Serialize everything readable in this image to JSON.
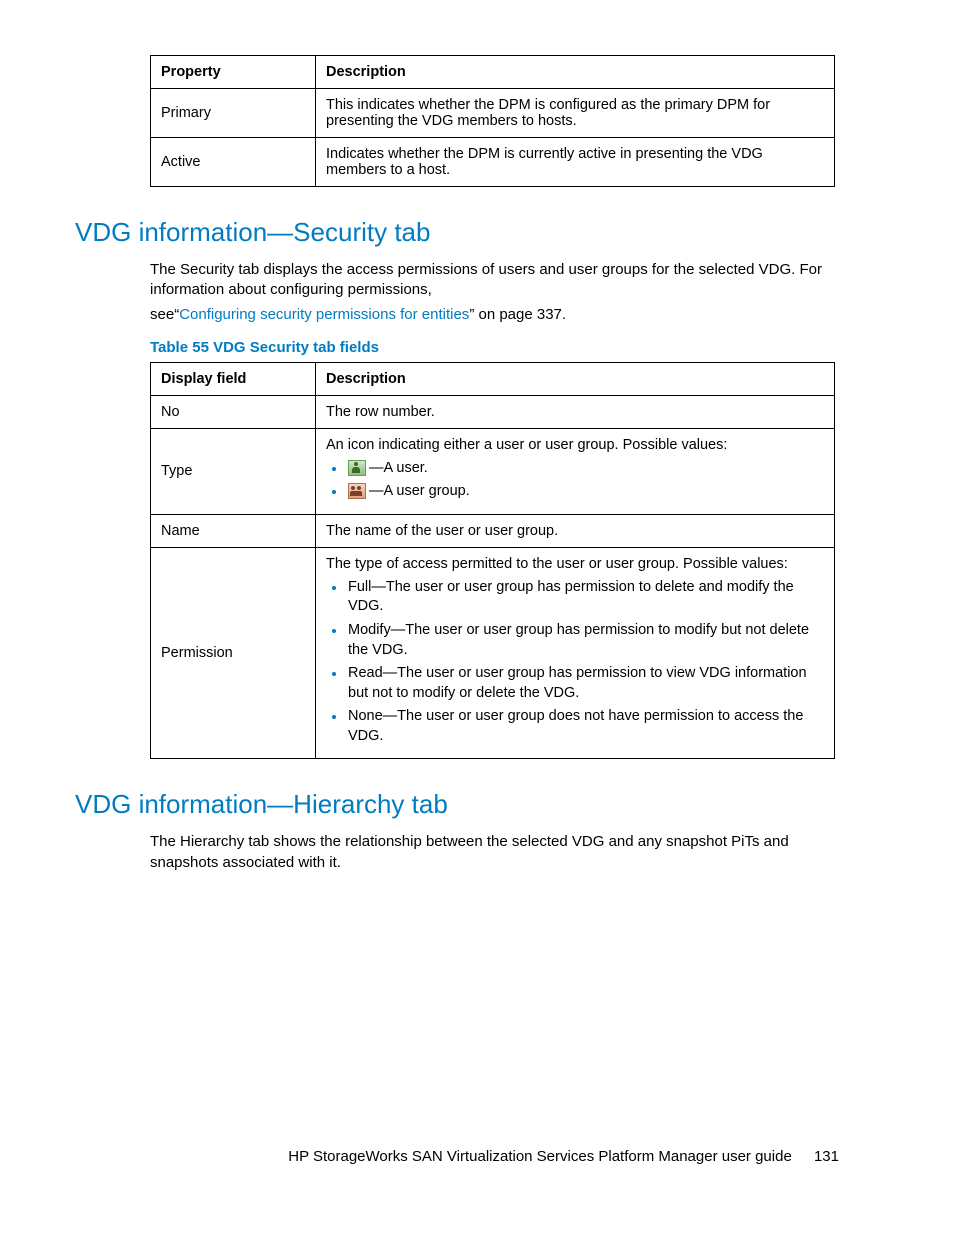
{
  "table1": {
    "headers": [
      "Property",
      "Description"
    ],
    "rows": [
      {
        "property": "Primary",
        "description": "This indicates whether the DPM is configured as the primary DPM for presenting the VDG members to hosts."
      },
      {
        "property": "Active",
        "description": "Indicates whether the DPM is currently active in presenting the VDG members to a host."
      }
    ]
  },
  "security": {
    "heading": "VDG information—Security tab",
    "intro_a": "The Security tab displays the access permissions of users and user groups for the selected VDG. For information about configuring permissions,",
    "intro_see": "see",
    "link_text": "Configuring security permissions for entities",
    "intro_tail": " on page 337.",
    "table_caption": "Table 55 VDG Security tab fields",
    "headers": [
      "Display field",
      "Description"
    ],
    "row_no": {
      "field": "No",
      "desc": "The row number."
    },
    "row_type": {
      "field": "Type",
      "intro": "An icon indicating either a user or user group. Possible values:",
      "user_label": "—A user.",
      "group_label": "—A user group."
    },
    "row_name": {
      "field": "Name",
      "desc": "The name of the user or user group."
    },
    "row_perm": {
      "field": "Permission",
      "intro": "The type of access permitted to the user or user group. Possible values:",
      "items": [
        "Full—The user or user group has permission to delete and modify the VDG.",
        "Modify—The user or user group has permission to modify but not delete the VDG.",
        "Read—The user or user group has permission to view VDG information but not to modify or delete the VDG.",
        "None—The user or user group does not have permission to access the VDG."
      ]
    }
  },
  "hierarchy": {
    "heading": "VDG information—Hierarchy tab",
    "text": "The Hierarchy tab shows the relationship between the selected VDG and any snapshot PiTs and snapshots associated with it."
  },
  "footer": {
    "title": "HP StorageWorks SAN Virtualization Services Platform Manager user guide",
    "page": "131"
  }
}
